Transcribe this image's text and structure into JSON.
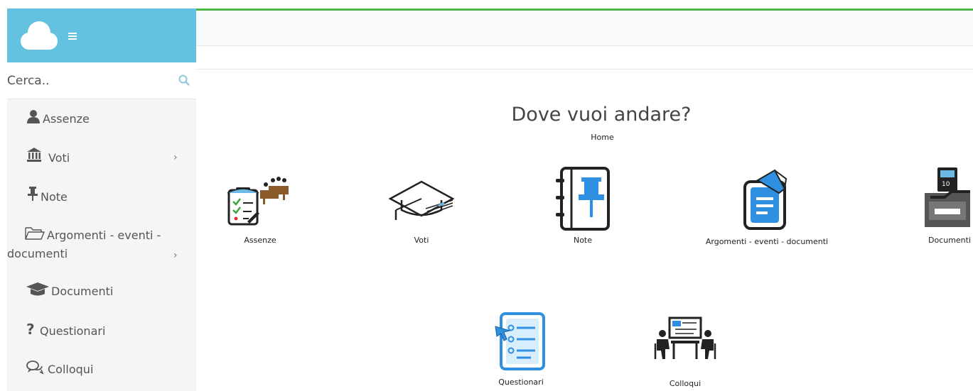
{
  "sidebar": {
    "search_placeholder": "Cerca..",
    "items": [
      {
        "label": "Assenze",
        "icon": "user-icon"
      },
      {
        "label": "Voti",
        "icon": "bank-icon",
        "has_submenu": true
      },
      {
        "label": "Note",
        "icon": "pin-icon"
      },
      {
        "label": "Argomenti - eventi -",
        "label2": "documenti",
        "icon": "folder-icon",
        "has_submenu": true
      },
      {
        "label": "Documenti",
        "icon": "graduation-cap-icon"
      },
      {
        "label": "Questionari",
        "icon": "question-icon"
      },
      {
        "label": "Colloqui",
        "icon": "chat-icon"
      }
    ],
    "chevron": "›"
  },
  "main": {
    "title": "Dove vuoi andare?",
    "breadcrumb": "Home",
    "tiles": [
      {
        "label": "Assenze"
      },
      {
        "label": "Voti"
      },
      {
        "label": "Note"
      },
      {
        "label": "Argomenti - eventi - documenti"
      },
      {
        "label": "Documenti"
      },
      {
        "label": "Questionari"
      },
      {
        "label": "Colloqui"
      }
    ]
  },
  "colors": {
    "header": "#63c2df",
    "accent_line": "#4bb64a",
    "icon_blue": "#2f8fe0"
  }
}
